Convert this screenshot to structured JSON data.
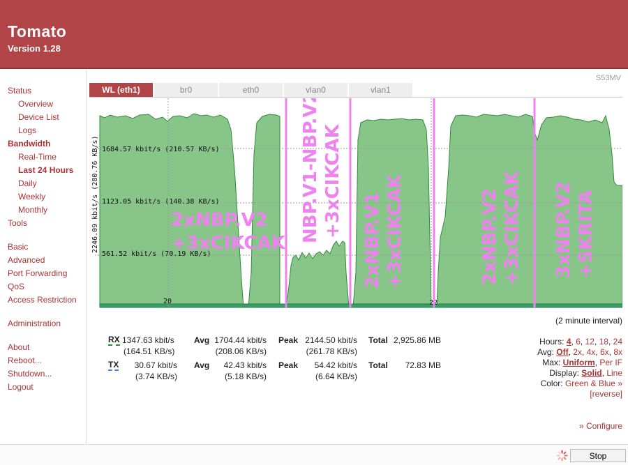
{
  "header": {
    "title": "Tomato",
    "version": "Version 1.28"
  },
  "hostname": "S53MV",
  "sidebar": {
    "items": [
      "Status",
      "Overview",
      "Device List",
      "Logs",
      "Bandwidth",
      "Real-Time",
      "Last 24 Hours",
      "Daily",
      "Weekly",
      "Monthly",
      "Tools",
      "Basic",
      "Advanced",
      "Port Forwarding",
      "QoS",
      "Access Restriction",
      "Administration",
      "About",
      "Reboot...",
      "Shutdown...",
      "Logout"
    ]
  },
  "tabs": [
    "WL (eth1)",
    "br0",
    "eth0",
    "vlan0",
    "vlan1"
  ],
  "active_tab": "WL (eth1)",
  "graph": {
    "y_max_label": "2246.09 kbit/s (280.76 KB/s)",
    "grid_labels": [
      "1684.57 kbit/s (210.57 KB/s)",
      "1123.05 kbit/s (140.38 KB/s)",
      "561.52 kbit/s (70.19 KB/s)"
    ],
    "hour_labels": [
      "20",
      "22"
    ],
    "annotations": [
      "2xNBP.V2",
      "+3xCIKCAK",
      "NBP.V1-NBP.V2",
      "+3xCIKCAK",
      "2xNBP.V1",
      "+3xCIKCAK",
      "2xNBP.V2",
      "+3xCIKCAK",
      "3xNBP.V2",
      "+SKRITA"
    ],
    "colors": {
      "rx_fill": "#88c589",
      "rx_line": "#2e8b3a",
      "tx_fill": "#3d9d6a",
      "marker": "#ee82ee"
    }
  },
  "interval": "(2 minute interval)",
  "stats": {
    "rx": {
      "label": "RX",
      "rate": "1347.63 kbit/s",
      "rate_kb": "(164.51 KB/s)",
      "avg_label": "Avg",
      "avg": "1704.44 kbit/s",
      "avg_kb": "(208.06 KB/s)",
      "peak_label": "Peak",
      "peak": "2144.50 kbit/s",
      "peak_kb": "(261.78 KB/s)",
      "total_label": "Total",
      "total": "2,925.86 MB"
    },
    "tx": {
      "label": "TX",
      "rate": "30.67 kbit/s",
      "rate_kb": "(3.74 KB/s)",
      "avg_label": "Avg",
      "avg": "42.43 kbit/s",
      "avg_kb": "(5.18 KB/s)",
      "peak_label": "Peak",
      "peak": "54.42 kbit/s",
      "peak_kb": "(6.64 KB/s)",
      "total_label": "Total",
      "total": "72.83 MB"
    }
  },
  "options": {
    "hours": {
      "label": "Hours:",
      "values": [
        "4",
        "6",
        "12",
        "18",
        "24"
      ]
    },
    "avg": {
      "label": "Avg:",
      "values": [
        "Off",
        "2x",
        "4x",
        "6x",
        "8x"
      ]
    },
    "max": {
      "label": "Max:",
      "values": [
        "Uniform",
        "Per IF"
      ]
    },
    "display": {
      "label": "Display:",
      "values": [
        "Solid",
        "Line"
      ]
    },
    "color": {
      "label": "Color:",
      "value": "Green & Blue »"
    },
    "reverse": "[reverse]"
  },
  "configure": "» Configure",
  "stop_button": "Stop"
}
